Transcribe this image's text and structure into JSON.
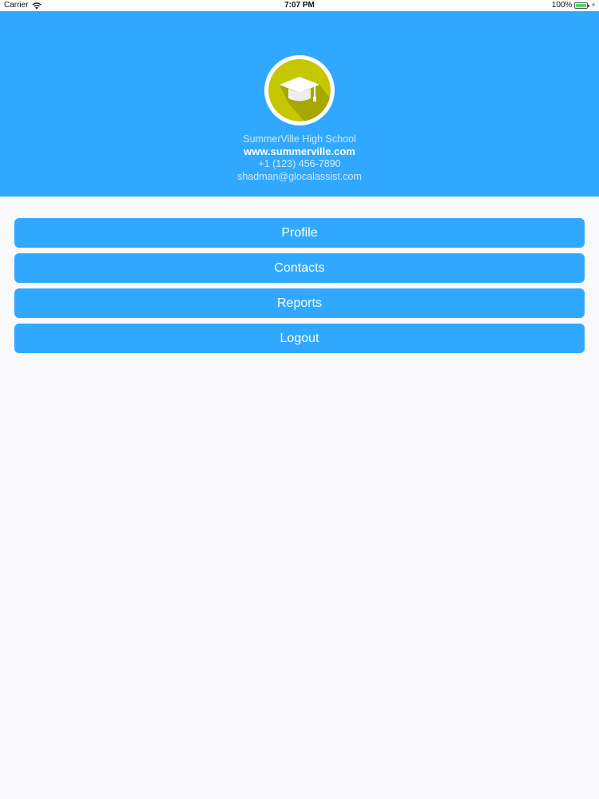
{
  "status_bar": {
    "carrier": "Carrier",
    "time": "7:07 PM",
    "battery_percent": "100%",
    "battery_level": 1.0,
    "icons": [
      "wifi-icon",
      "battery-icon",
      "charging-bolt-icon"
    ]
  },
  "header": {
    "background_color": "#31a8ff",
    "logo_icon": "graduation-cap-icon",
    "school_name": "SummerVille High School",
    "website": "www.summerville.com",
    "phone": "+1 (123) 456-7890",
    "email": "shadman@glocalassist.com"
  },
  "menu": {
    "button_color": "#31a8ff",
    "items": [
      {
        "label": "Profile"
      },
      {
        "label": "Contacts"
      },
      {
        "label": "Reports"
      },
      {
        "label": "Logout"
      }
    ]
  }
}
